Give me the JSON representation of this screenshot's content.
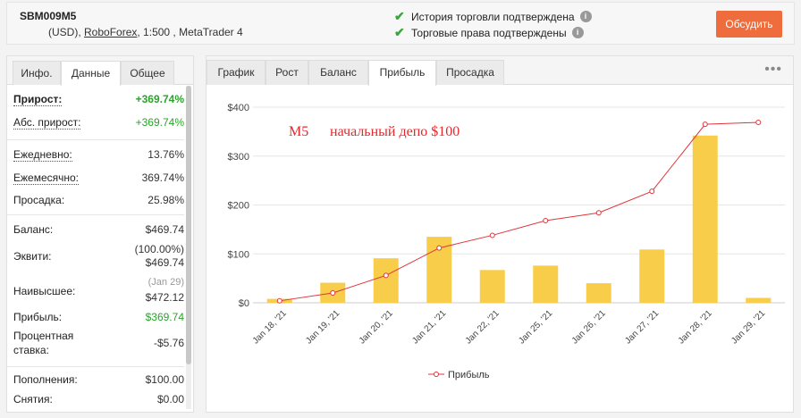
{
  "header": {
    "account_name": "SBM009M5",
    "currency": "(USD),",
    "broker": "RoboForex",
    "leverage_platform": ", 1:500 , MetaTrader 4",
    "verify_history": "История торговли подтверждена",
    "verify_rights": "Торговые права подтверждены",
    "discuss_label": "Обсудить"
  },
  "left_tabs": [
    "Инфо.",
    "Данные",
    "Общее"
  ],
  "left_active_tab": "Данные",
  "stats": {
    "gain_label": "Прирост:",
    "gain_value": "+369.74%",
    "abs_gain_label": "Абс. прирост:",
    "abs_gain_value": "+369.74%",
    "daily_label": "Ежедневно:",
    "daily_value": "13.76%",
    "monthly_label": "Ежемесячно:",
    "monthly_value": "369.74%",
    "drawdown_label": "Просадка:",
    "drawdown_value": "25.98%",
    "balance_label": "Баланс:",
    "balance_value": "$469.74",
    "equity_label": "Эквити:",
    "equity_pct": "(100.00%)",
    "equity_value": "$469.74",
    "highest_label": "Наивысшее:",
    "highest_date": "(Jan 29)",
    "highest_value": "$472.12",
    "profit_label": "Прибыль:",
    "profit_value": "$369.74",
    "interest_label_1": "Процентная",
    "interest_label_2": "ставка:",
    "interest_value": "-$5.76",
    "deposits_label": "Пополнения:",
    "deposits_value": "$100.00",
    "withdrawals_label": "Снятия:",
    "withdrawals_value": "$0.00"
  },
  "right_tabs": [
    "График",
    "Рост",
    "Баланс",
    "Прибыль",
    "Просадка"
  ],
  "right_active_tab": "Прибыль",
  "more_icon": "•••",
  "colors": {
    "accent": "#ef6c3c",
    "green": "#29a329",
    "bar": "#f7cd4a",
    "line": "#e0343a",
    "annotation": "#e8262b"
  },
  "chart_data": {
    "type": "bar",
    "annotation_left": "M5",
    "annotation_right": "начальный депо $100",
    "categories": [
      "Jan 18, '21",
      "Jan 19, '21",
      "Jan 20, '21",
      "Jan 21, '21",
      "Jan 22, '21",
      "Jan 25, '21",
      "Jan 26, '21",
      "Jan 27, '21",
      "Jan 28, '21",
      "Jan 29, '21"
    ],
    "y_ticks": [
      "$0",
      "$100",
      "$200",
      "$300",
      "$400"
    ],
    "ylim": [
      0,
      400
    ],
    "series": [
      {
        "type": "bar",
        "values": [
          8,
          41,
          91,
          135,
          67,
          76,
          40,
          109,
          342,
          10
        ]
      },
      {
        "type": "line",
        "name": "Прибыль",
        "values": [
          4,
          20,
          56,
          112,
          138,
          168,
          184,
          228,
          365,
          369
        ]
      }
    ],
    "legend": "Прибыль",
    "legend_position": "bottom",
    "grid": true
  }
}
